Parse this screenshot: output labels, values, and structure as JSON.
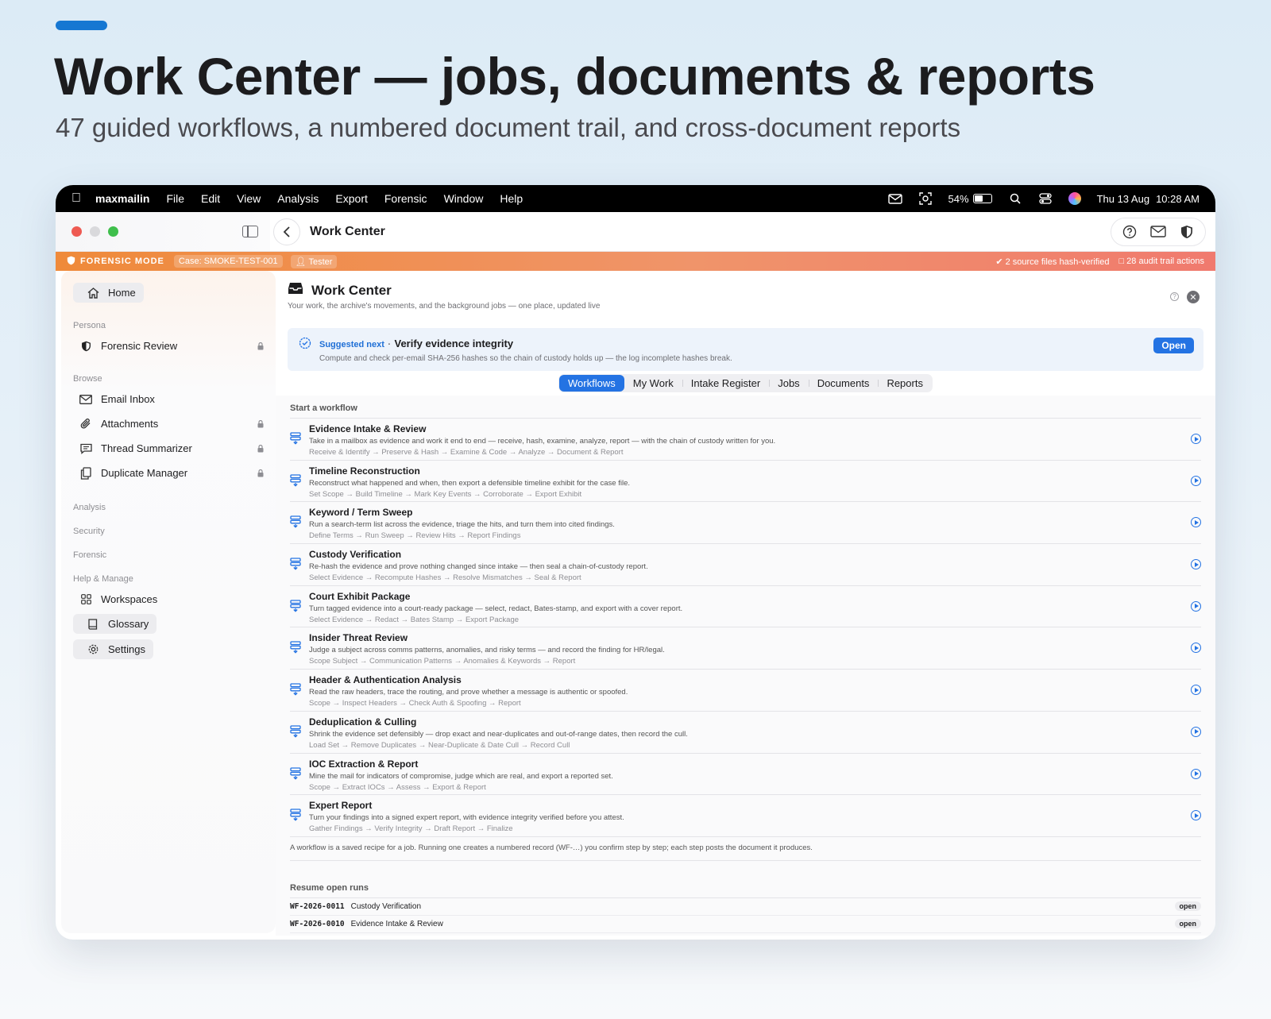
{
  "hero": {
    "title": "Work Center — jobs, documents & reports",
    "subtitle": "47 guided workflows, a numbered document trail, and cross-document reports"
  },
  "menubar": {
    "app_name": "maxmailin",
    "menus": [
      "File",
      "Edit",
      "View",
      "Analysis",
      "Export",
      "Forensic",
      "Window",
      "Help"
    ],
    "battery": "54%",
    "battery_level": 0.54,
    "date": "Thu 13 Aug",
    "time": "10:28 AM"
  },
  "window": {
    "title": "Work Center"
  },
  "forensic_banner": {
    "mode": "FORENSIC MODE",
    "case": "Case: SMOKE-TEST-001",
    "user": "Tester",
    "hash_status": "2 source files hash-verified",
    "audit": "28 audit trail actions"
  },
  "sidebar": {
    "home": "Home",
    "persona_label": "Persona",
    "persona": "Forensic Review",
    "browse_label": "Browse",
    "browse_items": [
      "Email Inbox",
      "Attachments",
      "Thread Summarizer",
      "Duplicate Manager"
    ],
    "analysis_label": "Analysis",
    "security_label": "Security",
    "forensic_label": "Forensic",
    "help_label": "Help & Manage",
    "workspaces": "Workspaces",
    "glossary": "Glossary",
    "settings": "Settings"
  },
  "main": {
    "title": "Work Center",
    "subtitle": "Your work, the archive's movements, and the background jobs — one place, updated live",
    "suggest_label": "Suggested next",
    "suggest_sep": "·",
    "suggest_title": "Verify evidence integrity",
    "suggest_desc": "Compute and check per-email SHA-256 hashes so the chain of custody holds up — the log incomplete hashes break.",
    "open_label": "Open",
    "tabs": [
      "Workflows",
      "My Work",
      "Intake Register",
      "Jobs",
      "Documents",
      "Reports"
    ],
    "start_label": "Start a workflow",
    "footnote": "A workflow is a saved recipe for a job. Running one creates a numbered record (WF-…) you confirm step by step; each step posts the document it produces.",
    "resume_label": "Resume open runs"
  },
  "workflows": [
    {
      "title": "Evidence Intake & Review",
      "desc": "Take in a mailbox as evidence and work it end to end — receive, hash, examine, analyze, report — with the chain of custody written for you.",
      "steps": "Receive & Identify → Preserve & Hash → Examine & Code → Analyze → Document & Report"
    },
    {
      "title": "Timeline Reconstruction",
      "desc": "Reconstruct what happened and when, then export a defensible timeline exhibit for the case file.",
      "steps": "Set Scope → Build Timeline → Mark Key Events → Corroborate → Export Exhibit"
    },
    {
      "title": "Keyword / Term Sweep",
      "desc": "Run a search-term list across the evidence, triage the hits, and turn them into cited findings.",
      "steps": "Define Terms → Run Sweep → Review Hits → Report Findings"
    },
    {
      "title": "Custody Verification",
      "desc": "Re-hash the evidence and prove nothing changed since intake — then seal a chain-of-custody report.",
      "steps": "Select Evidence → Recompute Hashes → Resolve Mismatches → Seal & Report"
    },
    {
      "title": "Court Exhibit Package",
      "desc": "Turn tagged evidence into a court-ready package — select, redact, Bates-stamp, and export with a cover report.",
      "steps": "Select Evidence → Redact → Bates Stamp → Export Package"
    },
    {
      "title": "Insider Threat Review",
      "desc": "Judge a subject across comms patterns, anomalies, and risky terms — and record the finding for HR/legal.",
      "steps": "Scope Subject → Communication Patterns → Anomalies & Keywords → Report"
    },
    {
      "title": "Header & Authentication Analysis",
      "desc": "Read the raw headers, trace the routing, and prove whether a message is authentic or spoofed.",
      "steps": "Scope → Inspect Headers → Check Auth & Spoofing → Report"
    },
    {
      "title": "Deduplication & Culling",
      "desc": "Shrink the evidence set defensibly — drop exact and near-duplicates and out-of-range dates, then record the cull.",
      "steps": "Load Set → Remove Duplicates → Near-Duplicate & Date Cull → Record Cull"
    },
    {
      "title": "IOC Extraction & Report",
      "desc": "Mine the mail for indicators of compromise, judge which are real, and export a reported set.",
      "steps": "Scope → Extract IOCs → Assess → Export & Report"
    },
    {
      "title": "Expert Report",
      "desc": "Turn your findings into a signed expert report, with evidence integrity verified before you attest.",
      "steps": "Gather Findings → Verify Integrity → Draft Report → Finalize"
    }
  ],
  "open_runs": [
    {
      "id": "WF-2026-0011",
      "name": "Custody Verification",
      "status": "open"
    },
    {
      "id": "WF-2026-0010",
      "name": "Evidence Intake & Review",
      "status": "open"
    }
  ],
  "colors": {
    "accent": "#2473e3",
    "brand_bar": "#1677d2",
    "forensic_banner": "#ef8a3a"
  }
}
